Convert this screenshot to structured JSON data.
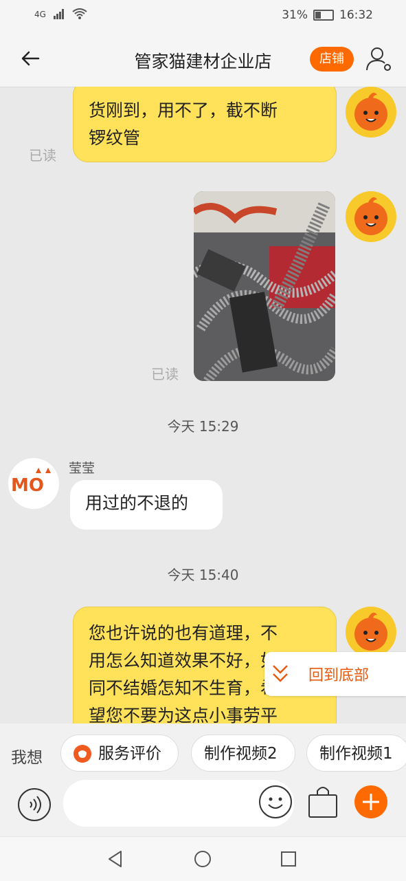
{
  "status_bar": {
    "network": "4G",
    "battery": "31%",
    "time": "16:32"
  },
  "header": {
    "title": "管家猫建材企业店",
    "shop_button": "店铺"
  },
  "messages": {
    "m1": {
      "text_line1": "货刚到，用不了，截不断",
      "text_line2": "锣纹管",
      "read": "已读"
    },
    "m2": {
      "read": "已读"
    },
    "t1": "今天  15:29",
    "m3": {
      "sender": "莹莹",
      "text": "用过的不退的"
    },
    "t2": "今天  15:40",
    "m4": {
      "lines": [
        "您也许说的也有道理，不",
        "用怎么知道效果不好，如",
        "同不结婚怎知不生育，希",
        "望您不要为这点小事劳平"
      ]
    }
  },
  "back_to_bottom": "回到底部",
  "suggestions": {
    "lead": "我想",
    "chips": [
      "服务评价",
      "制作视频2",
      "制作视频1"
    ]
  },
  "colors": {
    "accent": "#ff6a00",
    "my_bubble": "#ffe25a",
    "background": "#e9e9e9"
  }
}
